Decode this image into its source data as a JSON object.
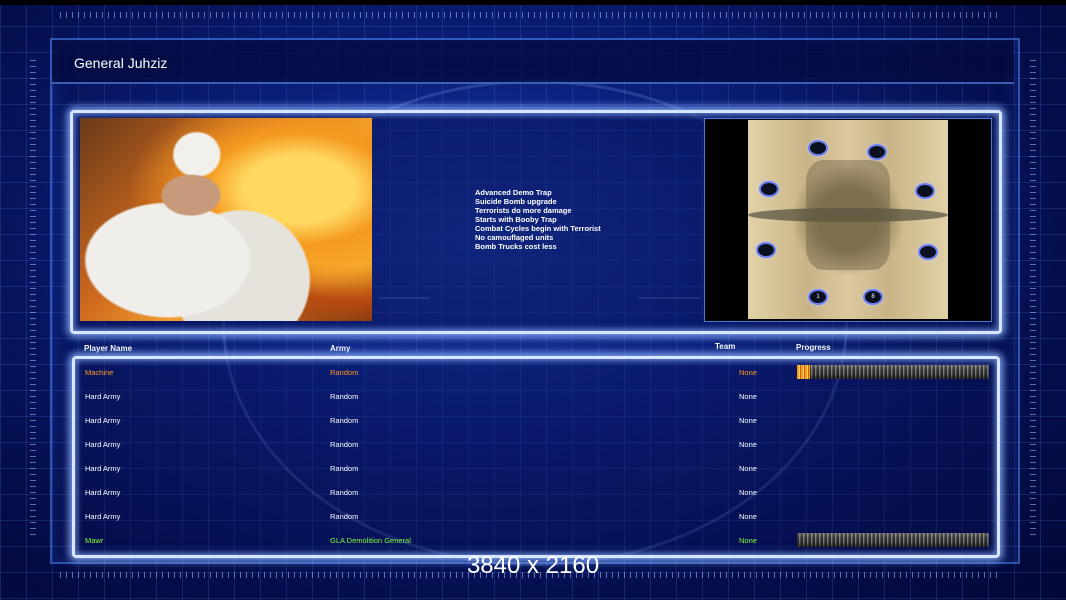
{
  "screen": {
    "title": "General Juhziz",
    "resolution_caption": "3840 x 2160"
  },
  "perks": [
    "Advanced Demo Trap",
    "Suicide Bomb upgrade",
    "Terrorists do more damage",
    "Starts with Booby Trap",
    "Combat Cycles begin with Terrorist",
    "No camouflaged units",
    "Bomb Trucks cost less"
  ],
  "map": {
    "start_positions": [
      {
        "label": ""
      },
      {
        "label": ""
      },
      {
        "label": ""
      },
      {
        "label": ""
      },
      {
        "label": ""
      },
      {
        "label": ""
      },
      {
        "label": "1"
      },
      {
        "label": "8"
      }
    ]
  },
  "table": {
    "headers": {
      "player_name": "Player Name",
      "army": "Army",
      "team": "Team",
      "progress": "Progress"
    },
    "rows": [
      {
        "name": "Machine",
        "army": "Random",
        "team": "None",
        "color": "#ff9a20",
        "progress": 0.07
      },
      {
        "name": "Hard Army",
        "army": "Random",
        "team": "None",
        "color": "#ffffff",
        "progress": null
      },
      {
        "name": "Hard Army",
        "army": "Random",
        "team": "None",
        "color": "#ffffff",
        "progress": null
      },
      {
        "name": "Hard Army",
        "army": "Random",
        "team": "None",
        "color": "#ffffff",
        "progress": null
      },
      {
        "name": "Hard Army",
        "army": "Random",
        "team": "None",
        "color": "#ffffff",
        "progress": null
      },
      {
        "name": "Hard Army",
        "army": "Random",
        "team": "None",
        "color": "#ffffff",
        "progress": null
      },
      {
        "name": "Hard Army",
        "army": "Random",
        "team": "None",
        "color": "#ffffff",
        "progress": null
      },
      {
        "name": "Mawr",
        "army": "GLA Demolition General",
        "team": "None",
        "color": "#7cff3a",
        "progress": 0
      }
    ]
  }
}
